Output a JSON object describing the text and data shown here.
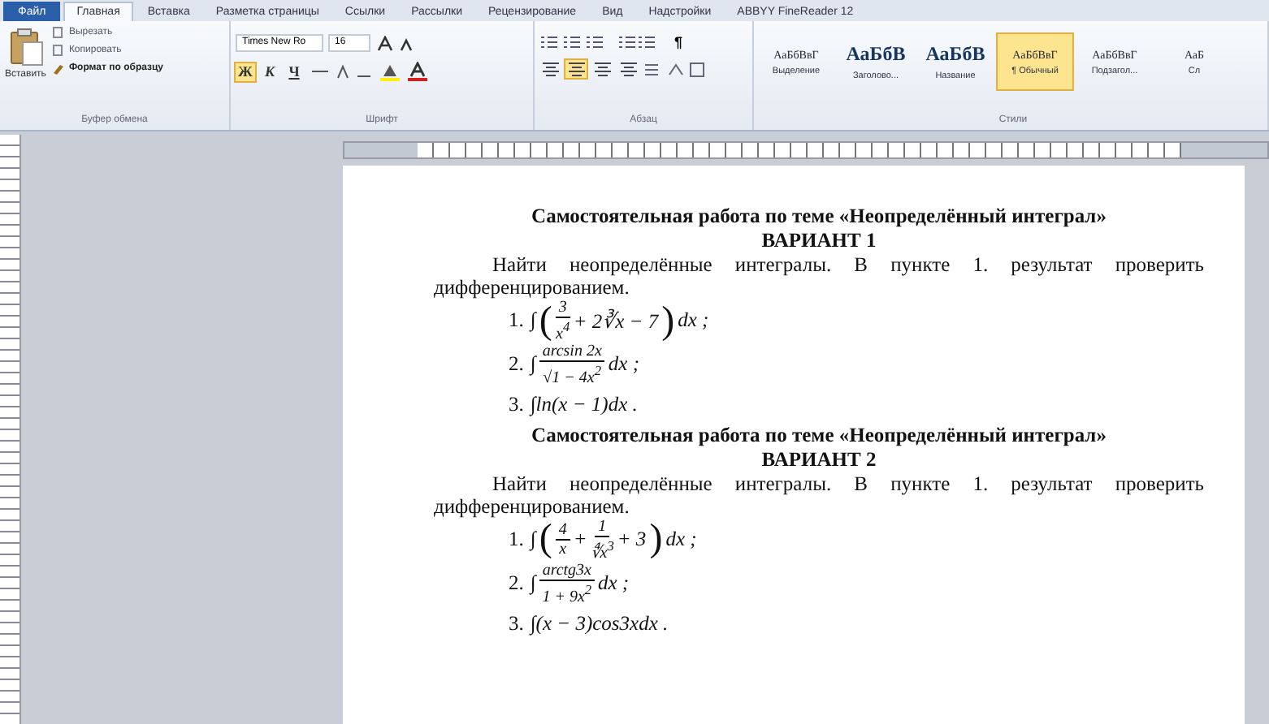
{
  "tabs": [
    {
      "label": "Файл",
      "kind": "file",
      "selected": false
    },
    {
      "label": "Главная",
      "kind": "tab",
      "selected": true
    },
    {
      "label": "Вставка",
      "kind": "tab",
      "selected": false
    },
    {
      "label": "Разметка страницы",
      "kind": "tab",
      "selected": false
    },
    {
      "label": "Ссылки",
      "kind": "tab",
      "selected": false
    },
    {
      "label": "Рассылки",
      "kind": "tab",
      "selected": false
    },
    {
      "label": "Рецензирование",
      "kind": "tab",
      "selected": false
    },
    {
      "label": "Вид",
      "kind": "tab",
      "selected": false
    },
    {
      "label": "Надстройки",
      "kind": "tab",
      "selected": false
    },
    {
      "label": "ABBYY FineReader 12",
      "kind": "tab",
      "selected": false
    }
  ],
  "clipboard": {
    "paste": "Вставить",
    "actions": [
      "Вырезать",
      "Копировать",
      "Формат по образцу"
    ],
    "group": "Буфер обмена"
  },
  "font": {
    "name": "Times New Ro",
    "size": "16",
    "format_buttons": [
      {
        "label": "Ж",
        "selected": true
      },
      {
        "label": "К",
        "selected": false
      },
      {
        "label": "Ч",
        "selected": false
      }
    ],
    "group": "Шрифт"
  },
  "paragraph": {
    "align_buttons": [
      {
        "selected": false
      },
      {
        "selected": true
      },
      {
        "selected": false
      },
      {
        "selected": false
      }
    ],
    "pilcrow": "¶",
    "group": "Абзац"
  },
  "styles": {
    "items": [
      {
        "preview": "АаБбВвГ",
        "label": "Выделение",
        "kind": "small",
        "selected": false
      },
      {
        "preview": "АаБбВ",
        "label": "Заголово...",
        "kind": "large",
        "selected": false
      },
      {
        "preview": "АаБбВ",
        "label": "Название",
        "kind": "large",
        "selected": false
      },
      {
        "preview": "АаБбВвГ",
        "label": "¶ Обычный",
        "kind": "small",
        "selected": true
      },
      {
        "preview": "АаБбВвГ",
        "label": "Подзагол...",
        "kind": "small",
        "selected": false
      },
      {
        "preview": "АаБ",
        "label": "Сл",
        "kind": "small",
        "selected": false
      }
    ],
    "group": "Стили"
  },
  "document": {
    "sections": [
      {
        "title": "Самостоятельная работа по теме «Неопределённый интеграл»",
        "variant": "ВАРИАНТ 1",
        "task": "Найти неопределённые интегралы. В пункте 1. результат проверить дифференцированием.",
        "problems": [
          {
            "number": "1.",
            "parts": [
              {
                "kind": "text",
                "text": "∫"
              },
              {
                "kind": "paren",
                "text": "("
              },
              {
                "kind": "frac",
                "num": "3",
                "den": "x$^{4}$"
              },
              {
                "kind": "text",
                "text": "+ 2∛x − 7"
              },
              {
                "kind": "paren",
                "text": ")"
              },
              {
                "kind": "text",
                "text": "dx ;"
              }
            ]
          },
          {
            "number": "2.",
            "parts": [
              {
                "kind": "text",
                "text": "∫"
              },
              {
                "kind": "frac",
                "num": "arcsin 2x",
                "den": "√1 − 4x$^{2}$"
              },
              {
                "kind": "text",
                "text": "dx ;"
              }
            ]
          },
          {
            "number": "3.",
            "parts": [
              {
                "kind": "text",
                "text": "∫ln(x − 1)dx ."
              }
            ]
          }
        ]
      },
      {
        "title": "Самостоятельная работа по теме «Неопределённый интеграл»",
        "variant": "ВАРИАНТ 2",
        "task": "Найти неопределённые интегралы. В пункте 1. результат проверить дифференцированием.",
        "problems": [
          {
            "number": "1.",
            "parts": [
              {
                "kind": "text",
                "text": "∫"
              },
              {
                "kind": "paren",
                "text": "("
              },
              {
                "kind": "frac",
                "num": "4",
                "den": "x"
              },
              {
                "kind": "text",
                "text": "+"
              },
              {
                "kind": "frac",
                "num": "1",
                "den": "∜x$^{3}$"
              },
              {
                "kind": "text",
                "text": "+ 3"
              },
              {
                "kind": "paren",
                "text": ")"
              },
              {
                "kind": "text",
                "text": "dx ;"
              }
            ]
          },
          {
            "number": "2.",
            "parts": [
              {
                "kind": "text",
                "text": "∫"
              },
              {
                "kind": "frac",
                "num": "arctg3x",
                "den": "1 + 9x$^{2}$"
              },
              {
                "kind": "text",
                "text": "dx ;"
              }
            ]
          },
          {
            "number": "3.",
            "parts": [
              {
                "kind": "text",
                "text": "∫(x − 3)cos3xdx ."
              }
            ]
          }
        ]
      }
    ]
  }
}
